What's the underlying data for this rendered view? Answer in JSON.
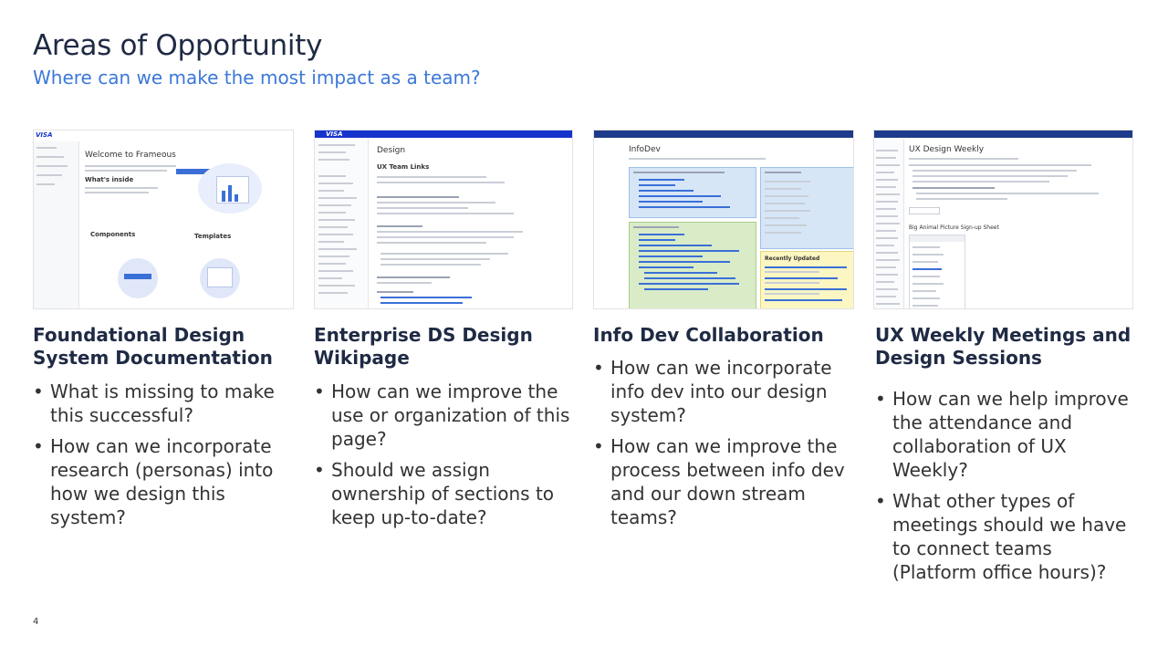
{
  "slide": {
    "title": "Areas of Opportunity",
    "subtitle": "Where can we make the most impact as a team?",
    "page_number": "4"
  },
  "columns": [
    {
      "heading": "Foundational Design System Documentation",
      "bullets": [
        "What is missing to make this successful?",
        "How can we incorporate research (personas) into how we design this system?"
      ]
    },
    {
      "heading": "Enterprise DS Design Wikipage",
      "bullets": [
        "How can we improve the use or organization of this page?",
        "Should we assign ownership of sections to keep up-to-date?"
      ]
    },
    {
      "heading": "Info Dev Collaboration",
      "bullets": [
        "How can we incorporate info dev into our design system?",
        "How can we improve the process between info dev and our down stream teams?"
      ]
    },
    {
      "heading": "UX Weekly Meetings and Design Sessions",
      "bullets": [
        "How can we help improve the attendance and collaboration of UX Weekly?",
        "What other types of meetings should we have to connect teams (Platform office hours)?"
      ]
    }
  ],
  "screenshots": {
    "s1": {
      "brand": "VISA",
      "heading": "Welcome to Frameous",
      "section": "What's inside",
      "card1": "Components",
      "card2": "Templates"
    },
    "s2": {
      "brand": "VISA",
      "heading": "Design",
      "section": "UX Team Links"
    },
    "s3": {
      "heading": "InfoDev",
      "panel": "Recently Updated"
    },
    "s4": {
      "heading": "UX Design Weekly",
      "table_title": "Big Animal Picture Sign-up Sheet"
    }
  },
  "colors": {
    "title": "#1f2a44",
    "subtitle": "#3b78d8",
    "visa_blue": "#1434cb"
  }
}
